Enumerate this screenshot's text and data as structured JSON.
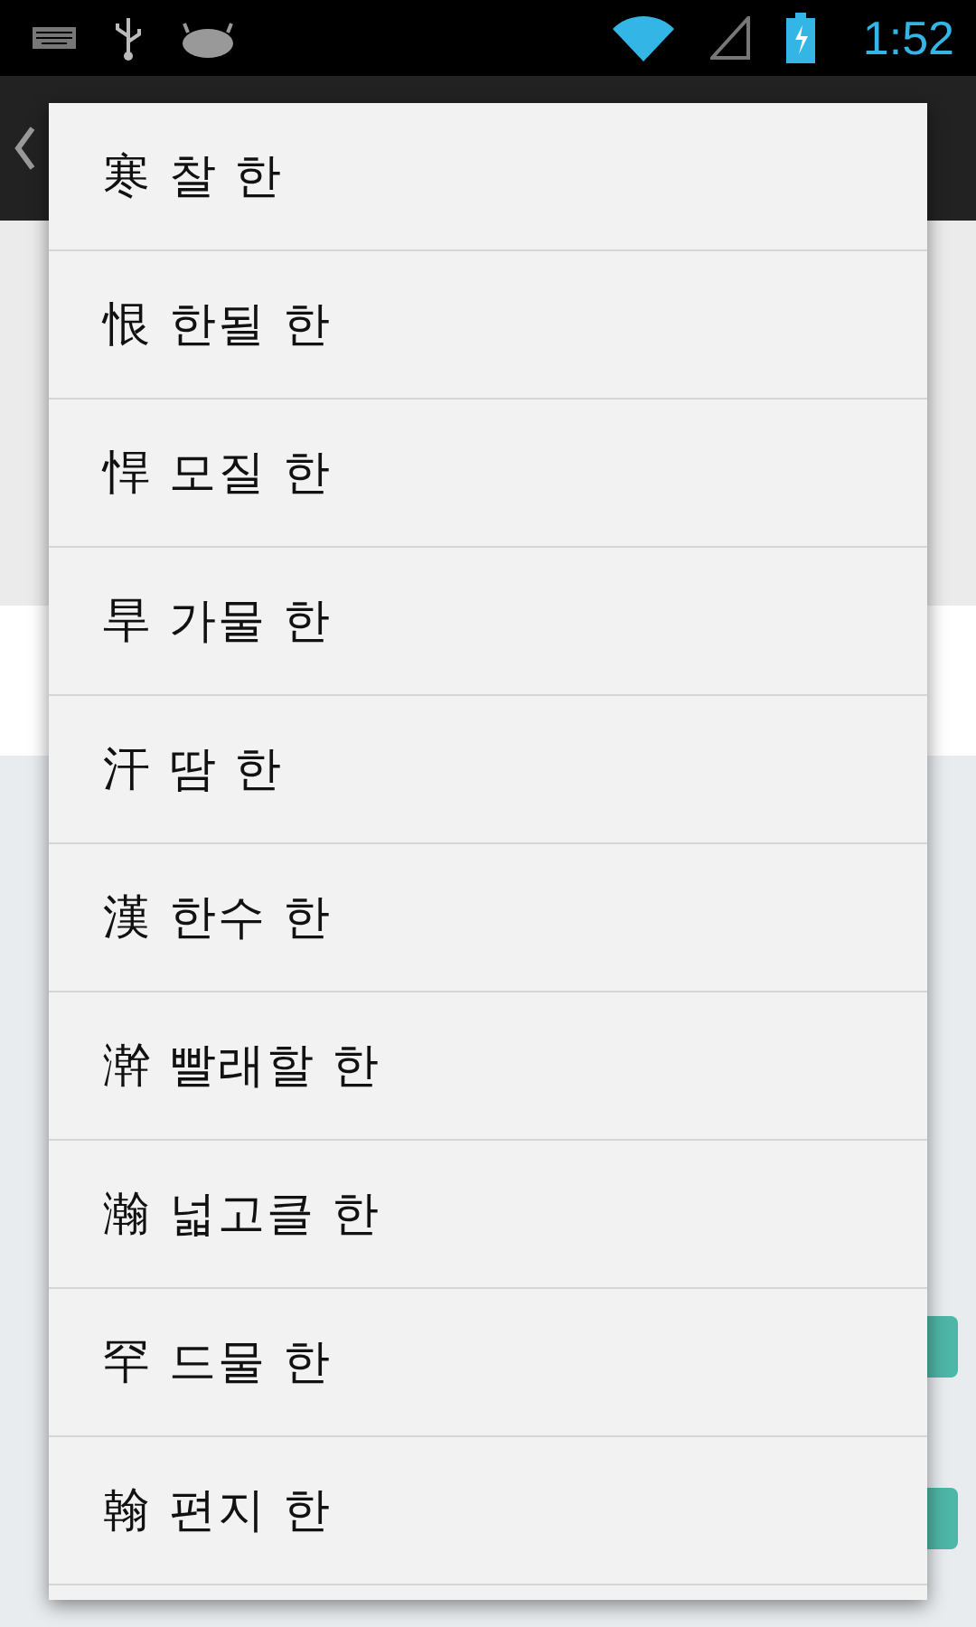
{
  "status_bar": {
    "time": "1:52"
  },
  "menu": {
    "items": [
      {
        "label": "寒 찰 한"
      },
      {
        "label": "恨 한될 한"
      },
      {
        "label": "悍 모질 한"
      },
      {
        "label": "旱 가물 한"
      },
      {
        "label": "汗 땀 한"
      },
      {
        "label": "漢 한수 한"
      },
      {
        "label": "澣 빨래할 한"
      },
      {
        "label": "瀚 넓고클 한"
      },
      {
        "label": "罕 드물 한"
      },
      {
        "label": "翰 편지 한"
      }
    ]
  }
}
